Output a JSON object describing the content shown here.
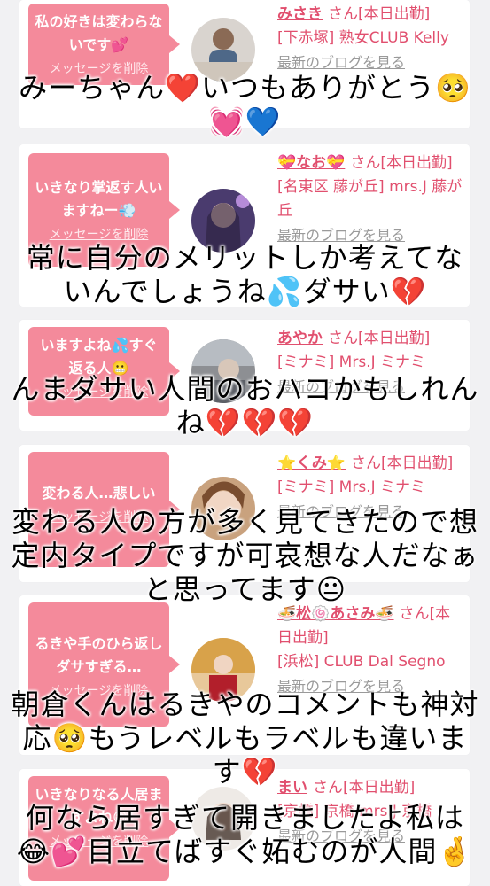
{
  "cards": [
    {
      "message": "私の好きは変わらないです💕",
      "delete_label": "メッセージを削除",
      "name": "みさき",
      "status": "さん[本日出勤]",
      "shop": "[下赤塚] 熟女CLUB Kelly",
      "blog_label": "最新のブログを見る"
    },
    {
      "message": "いきなり掌返す人いますねー💨",
      "delete_label": "メッセージを削除",
      "name": "💝なお💝",
      "status": "さん[本日出勤]",
      "shop": "[名東区 藤が丘] mrs.J 藤が丘",
      "blog_label": "最新のブログを見る"
    },
    {
      "message": "いますよね💦すぐ返る人😬",
      "delete_label": "メッセージを削除",
      "name": "あやか",
      "status": "さん[本日出勤]",
      "shop": "[ミナミ] Mrs.J ミナミ",
      "blog_label": "最新のブログを見る"
    },
    {
      "message": "変わる人…悲しい",
      "delete_label": "メッセージを削除",
      "name": "⭐くみ⭐",
      "status": "さん[本日出勤]",
      "shop": "[ミナミ] Mrs.J ミナミ",
      "blog_label": "最新のブログを見る"
    },
    {
      "message": "るきや手のひら返しダサすぎる…",
      "delete_label": "メッセージを削除",
      "name": "🍜松🍥あさみ🍜",
      "status": "さん[本日出勤]",
      "shop": "[浜松] CLUB Dal Segno",
      "blog_label": "最新のブログを見る"
    },
    {
      "message": "いきなりなる人居ますよね😅",
      "delete_label": "メッセージを削除",
      "name": "まい",
      "status": "さん[本日出勤]",
      "shop": "[京橋] 京橋 mrs.J 京橋",
      "blog_label": "最新のブログを見る"
    }
  ],
  "overlays": {
    "o1": "みーちゃん❤️いつもありがとう🥺\n💓💙",
    "o2": "常に自分のメリットしか考えてないんでしょうね💦ダサい💔",
    "o3": "んまダサい人間のおハコかもしれんね💔💔💔",
    "o4": "変わる人の方が多く見てきたので想定内タイプですが可哀想な人だなぁと思ってます😐",
    "o5": "朝倉くんはるきやのコメントも神対応🥺もうレベルもラベルも違います💔",
    "o6": "何なら居すぎて開きましたよ私は😂💕目立てばすぐ妬むのが人間🤞"
  },
  "colors": {
    "bubble": "#f48a9b",
    "accent": "#e14f6e",
    "background": "#f1f1f3"
  }
}
